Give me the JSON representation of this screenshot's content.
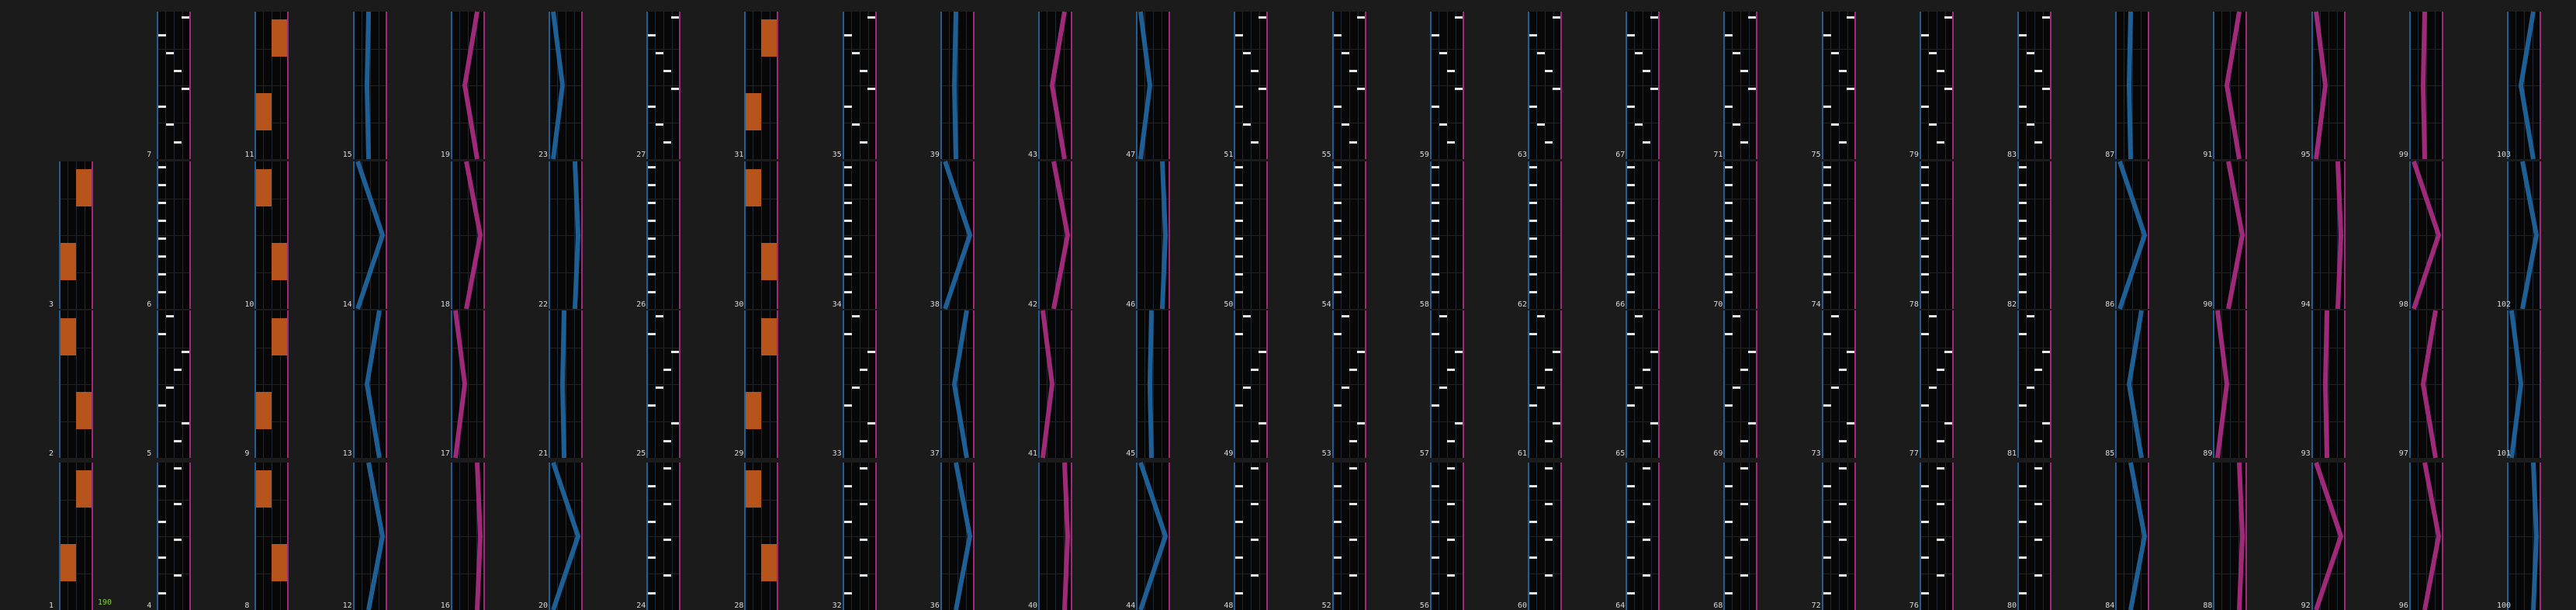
{
  "view": "chart-editor-overview",
  "measure_count": 103,
  "bpm_label": "190",
  "colors": {
    "background": "#1b1b1b",
    "measure_bg": "#070707",
    "left_wall": "#1e5f95",
    "right_wall": "#a02a7a",
    "hold": "#b6541c",
    "tap": "#e8e8e8",
    "mine": "#d46a1a",
    "roll": "#d0dce8",
    "bpm_text": "#7dd820"
  },
  "measure_numbers": [
    "1",
    "2",
    "3",
    "4",
    "5",
    "6",
    "7",
    "8",
    "9",
    "10",
    "11",
    "12",
    "13",
    "14",
    "15",
    "16",
    "17",
    "18",
    "19",
    "20",
    "21",
    "22",
    "23",
    "24",
    "25",
    "26",
    "27",
    "28",
    "29",
    "30",
    "31",
    "32",
    "33",
    "34",
    "35",
    "36",
    "37",
    "38",
    "39",
    "40",
    "41",
    "42",
    "43",
    "44",
    "45",
    "46",
    "47",
    "48",
    "49",
    "50",
    "51",
    "52",
    "53",
    "54",
    "55",
    "56",
    "57",
    "58",
    "59",
    "60",
    "61",
    "62",
    "63",
    "64",
    "65",
    "66",
    "67",
    "68",
    "69",
    "70",
    "71",
    "72",
    "73",
    "74",
    "75",
    "76",
    "77",
    "78",
    "79",
    "80",
    "81",
    "82",
    "83",
    "84",
    "85",
    "86",
    "87",
    "88",
    "89",
    "90",
    "91",
    "92",
    "93",
    "94",
    "95",
    "96",
    "97",
    "98",
    "99",
    "100",
    "101",
    "102",
    "103"
  ],
  "columns": [
    {
      "type": "hold"
    },
    {
      "type": "tap"
    },
    {
      "type": "hold"
    },
    {
      "type": "arc-l"
    },
    {
      "type": "arc-r"
    },
    {
      "type": "arc-l"
    },
    {
      "type": "tap"
    },
    {
      "type": "hold"
    },
    {
      "type": "tap"
    },
    {
      "type": "arc-l"
    },
    {
      "type": "arc-r"
    },
    {
      "type": "arc-l"
    },
    {
      "type": "tap"
    },
    {
      "type": "tap"
    },
    {
      "type": "tap"
    },
    {
      "type": "tap"
    },
    {
      "type": "tap"
    },
    {
      "type": "tap"
    },
    {
      "type": "tap"
    },
    {
      "type": "tap"
    },
    {
      "type": "tap"
    },
    {
      "type": "arc-l"
    },
    {
      "type": "arc-r"
    },
    {
      "type": "arc-r"
    },
    {
      "type": "arc-r"
    },
    {
      "type": "arc-l"
    },
    {
      "type": "tap"
    },
    {
      "type": "hold"
    },
    {
      "type": "hold"
    },
    {
      "type": "arc-l"
    },
    {
      "type": "arc-r"
    },
    {
      "type": "arc-r"
    },
    {
      "type": "tap"
    }
  ]
}
